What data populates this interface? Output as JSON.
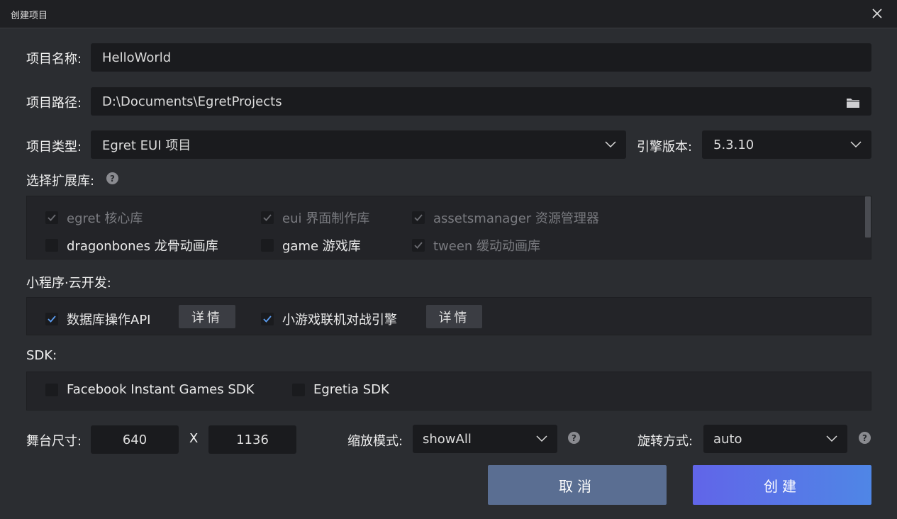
{
  "window": {
    "title": "创建项目"
  },
  "form": {
    "name_label": "项目名称:",
    "name_value": "HelloWorld",
    "path_label": "项目路径:",
    "path_value": "D:\\Documents\\EgretProjects",
    "type_label": "项目类型:",
    "type_value": "Egret EUI 项目",
    "engine_label": "引擎版本:",
    "engine_value": "5.3.10"
  },
  "libraries": {
    "label": "选择扩展库:",
    "items": [
      {
        "label": "egret 核心库",
        "checked": true,
        "disabled": true
      },
      {
        "label": "eui 界面制作库",
        "checked": true,
        "disabled": true
      },
      {
        "label": "assetsmanager 资源管理器",
        "checked": true,
        "disabled": true
      },
      {
        "label": "dragonbones 龙骨动画库",
        "checked": false,
        "disabled": false
      },
      {
        "label": "game 游戏库",
        "checked": false,
        "disabled": false
      },
      {
        "label": "tween 缓动动画库",
        "checked": true,
        "disabled": true
      }
    ]
  },
  "cloud": {
    "label": "小程序·云开发:",
    "items": [
      {
        "label": "数据库操作API",
        "checked": true,
        "detail": "详情"
      },
      {
        "label": "小游戏联机对战引擎",
        "checked": true,
        "detail": "详情"
      }
    ]
  },
  "sdk": {
    "label": "SDK:",
    "items": [
      {
        "label": "Facebook Instant Games SDK",
        "checked": false
      },
      {
        "label": "Egretia SDK",
        "checked": false
      }
    ]
  },
  "stage": {
    "size_label": "舞台尺寸:",
    "width": "640",
    "separator": "X",
    "height": "1136",
    "scale_label": "缩放模式:",
    "scale_value": "showAll",
    "rotate_label": "旋转方式:",
    "rotate_value": "auto"
  },
  "actions": {
    "cancel": "取消",
    "create": "创建"
  },
  "icons": {
    "close": "close-icon",
    "folder": "folder-icon",
    "chevron": "chevron-down-icon",
    "help": "help-icon",
    "check": "check-icon"
  },
  "colors": {
    "accent": "#5b73ea",
    "background": "#2b2d31",
    "field": "#1a1b1e"
  }
}
